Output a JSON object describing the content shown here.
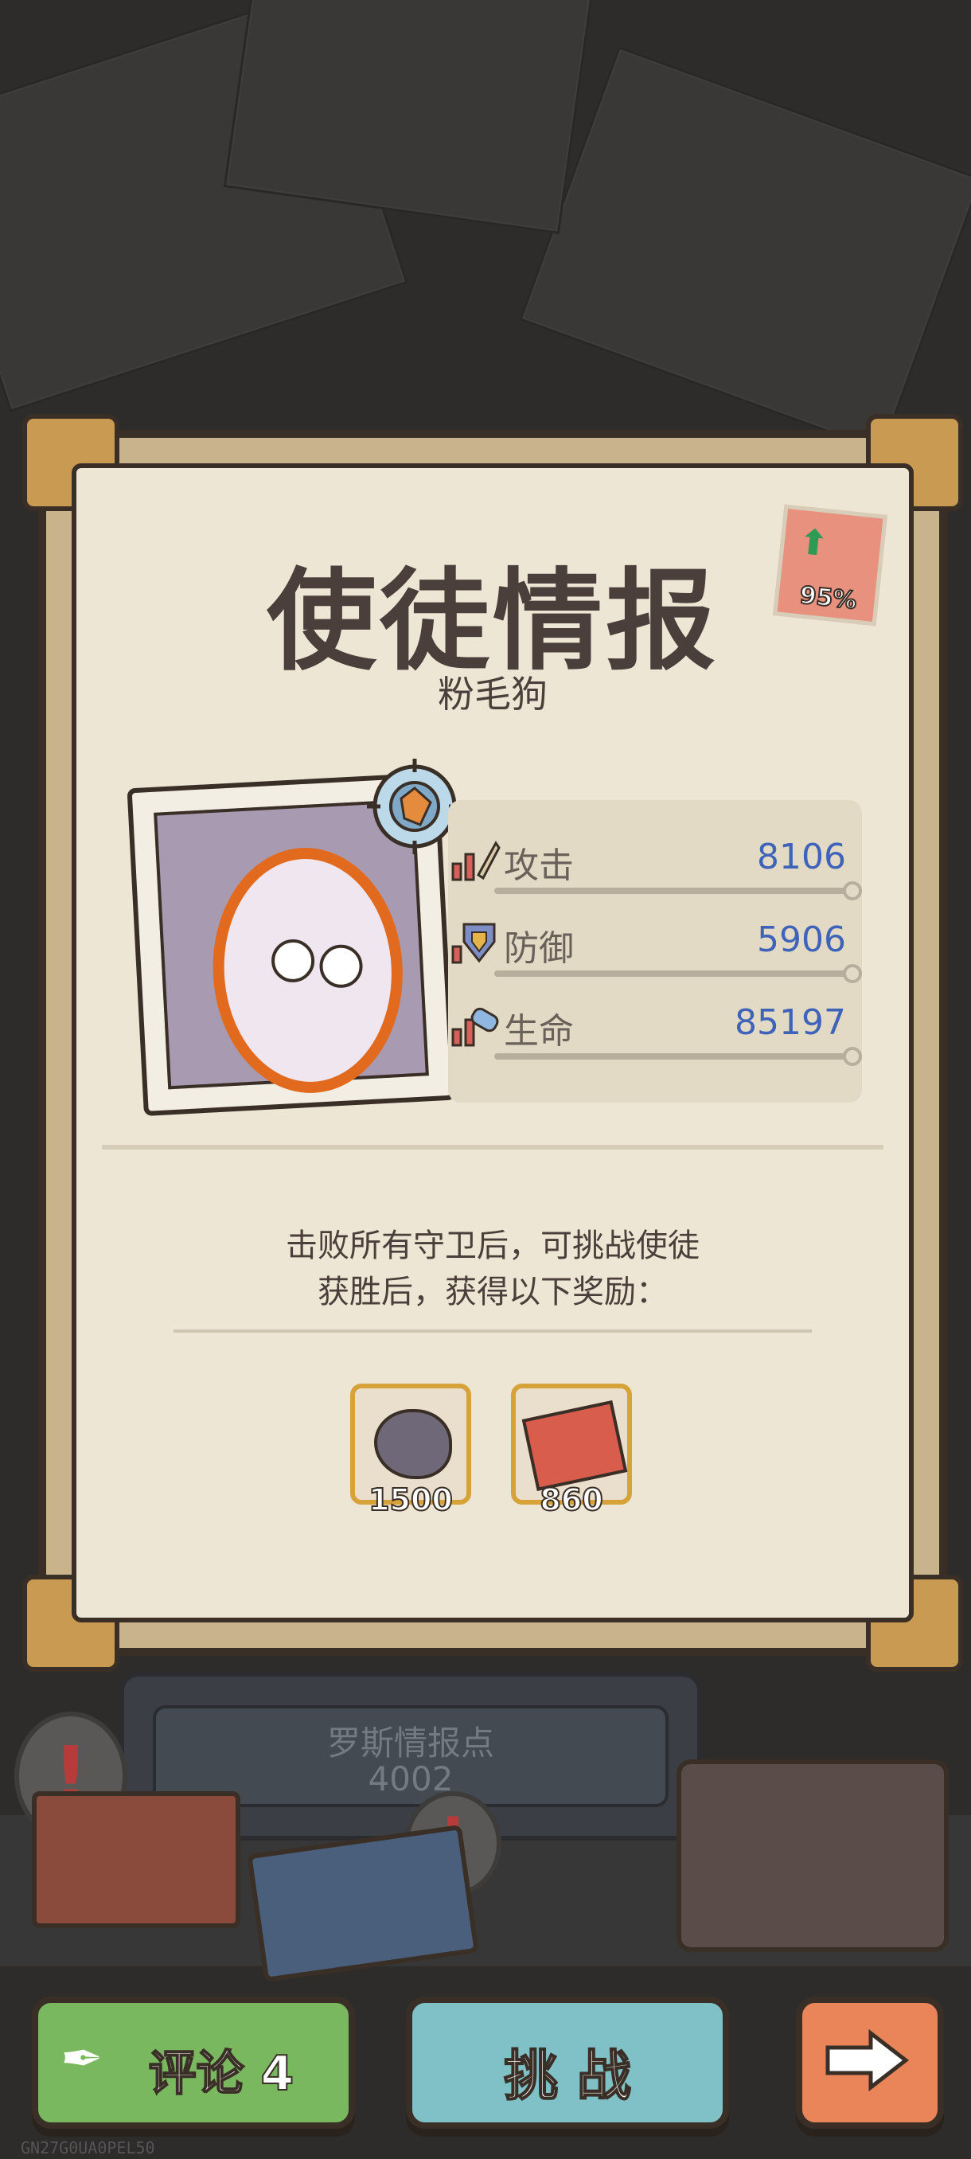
{
  "card": {
    "title": "使徒情报",
    "subtitle": "粉毛狗",
    "boost_percent": "95%"
  },
  "stats": [
    {
      "icon": "attack-icon",
      "label": "攻击",
      "value": "8106",
      "level": 0.95
    },
    {
      "icon": "defense-icon",
      "label": "防御",
      "value": "5906",
      "level": 0.95
    },
    {
      "icon": "health-icon",
      "label": "生命",
      "value": "85197",
      "level": 0.95
    }
  ],
  "description": {
    "line1": "击败所有守卫后，可挑战使徒",
    "line2": "获胜后，获得以下奖励："
  },
  "rewards": [
    {
      "icon": "ink-blob-icon",
      "count": "1500"
    },
    {
      "icon": "map-clue-icon",
      "count": "860"
    }
  ],
  "intel": {
    "label": "罗斯情报点",
    "value": "4002"
  },
  "buttons": {
    "comment_label": "评论 4",
    "challenge_label": "挑 战",
    "next_icon": "arrow-right-icon"
  },
  "watermark": "GN27G0UA0PEL50",
  "colors": {
    "title": "#4a3f3a",
    "stat_value": "#3f63b8",
    "comment_button": "#79b85f",
    "challenge_button": "#7fc1c6",
    "next_button": "#e98559"
  }
}
